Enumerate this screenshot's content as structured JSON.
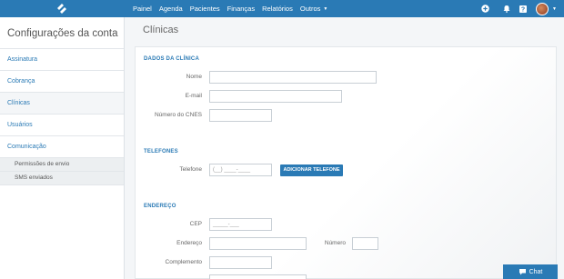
{
  "nav": {
    "items": [
      "Painel",
      "Agenda",
      "Pacientes",
      "Finanças",
      "Relatórios",
      "Outros"
    ]
  },
  "icons": {
    "logo": "app-logo",
    "add": "plus-circle-icon",
    "notifications": "bell-icon",
    "help": "help-icon",
    "avatar": "user-avatar"
  },
  "sidebar": {
    "title": "Configurações da conta",
    "items": [
      {
        "label": "Assinatura"
      },
      {
        "label": "Cobrança"
      },
      {
        "label": "Clínicas"
      },
      {
        "label": "Usuários"
      },
      {
        "label": "Comunicação"
      }
    ],
    "subitems": [
      {
        "label": "Permissões de envio"
      },
      {
        "label": "SMS enviados"
      }
    ]
  },
  "main": {
    "title": "Clínicas",
    "sections": {
      "dados": "DADOS DA CLÍNICA",
      "telefones": "TELEFONES",
      "endereco": "ENDEREÇO"
    },
    "fields": {
      "nome": {
        "label": "Nome",
        "value": ""
      },
      "email": {
        "label": "E-mail",
        "value": ""
      },
      "cnes": {
        "label": "Número do CNES",
        "value": ""
      },
      "telefone": {
        "label": "Telefone",
        "placeholder": "(__) ____-____"
      },
      "cep": {
        "label": "CEP",
        "placeholder": "_____-___"
      },
      "endereco": {
        "label": "Endereço",
        "value": ""
      },
      "numero": {
        "label": "Número",
        "value": ""
      },
      "complemento": {
        "label": "Complemento",
        "value": ""
      }
    },
    "add_phone_button": "ADICIONAR TELEFONE"
  },
  "chat": {
    "label": "Chat"
  },
  "colors": {
    "primary": "#2a7ab5",
    "background": "#f4f6f8"
  }
}
